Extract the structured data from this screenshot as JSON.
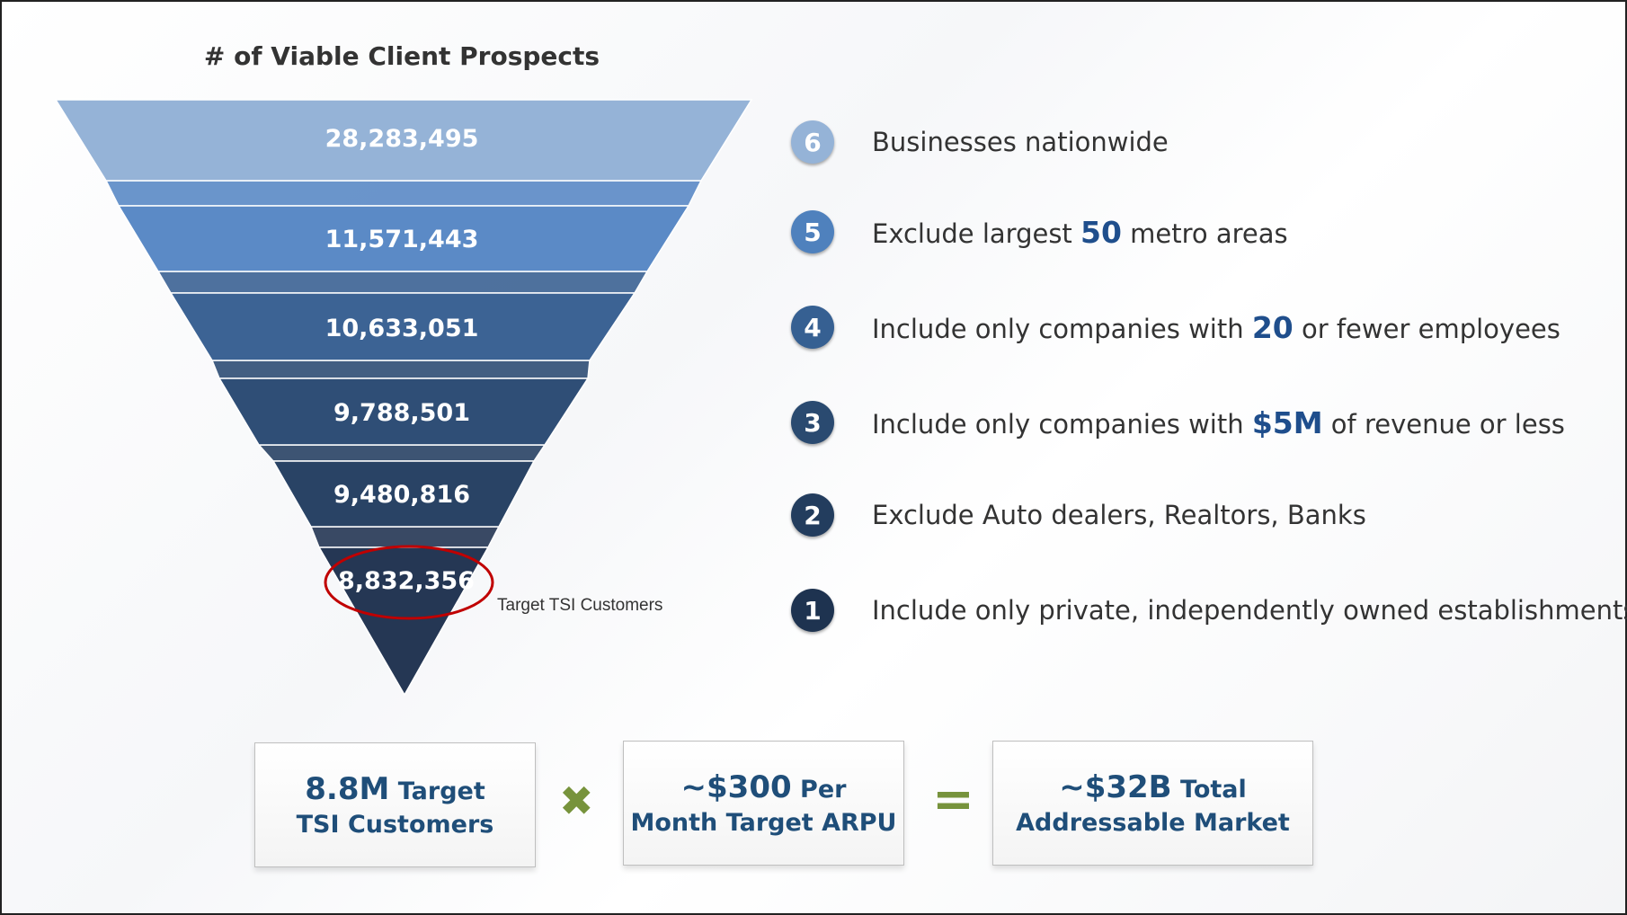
{
  "funnel": {
    "title": "# of Viable Client Prospects",
    "layers": [
      {
        "value": "28,283,495",
        "color": "#95b3d7"
      },
      {
        "value": "11,571,443",
        "color": "#5b8ac6"
      },
      {
        "value": "10,633,051",
        "color": "#3c6394"
      },
      {
        "value": "9,788,501",
        "color": "#2f4e76"
      },
      {
        "value": "9,480,816",
        "color": "#294365"
      },
      {
        "value": "8,832,356",
        "color": "#253754"
      }
    ],
    "target_label": "Target TSI Customers",
    "highlight_color": "#c00000"
  },
  "steps": [
    {
      "num": "6",
      "color": "#95b3d7",
      "parts": [
        {
          "t": "Businesses nationwide"
        }
      ]
    },
    {
      "num": "5",
      "color": "#4f81bd",
      "parts": [
        {
          "t": "Exclude largest "
        },
        {
          "t": "50",
          "hl": true
        },
        {
          "t": " metro areas"
        }
      ]
    },
    {
      "num": "4",
      "color": "#366092",
      "parts": [
        {
          "t": "Include only companies with "
        },
        {
          "t": "20",
          "hl": true
        },
        {
          "t": " or fewer employees"
        }
      ]
    },
    {
      "num": "3",
      "color": "#2a4a70",
      "parts": [
        {
          "t": "Include only companies with "
        },
        {
          "t": "$5M",
          "hl": true
        },
        {
          "t": " of revenue or less"
        }
      ]
    },
    {
      "num": "2",
      "color": "#233d5e",
      "parts": [
        {
          "t": "Exclude Auto dealers, Realtors, Banks"
        }
      ]
    },
    {
      "num": "1",
      "color": "#1e3350",
      "parts": [
        {
          "t": "Include only private, independently owned establishments"
        }
      ]
    }
  ],
  "equation": {
    "box1": {
      "big": "8.8M",
      "small": " Target",
      "line2": "TSI Customers"
    },
    "times": "✖",
    "box2": {
      "big": "~$300",
      "small": " Per",
      "line2": "Month Target ARPU"
    },
    "equals": "=",
    "box3": {
      "big": "~$32B",
      "small": " Total",
      "line2": "Addressable Market"
    },
    "accent": "#77933c"
  }
}
